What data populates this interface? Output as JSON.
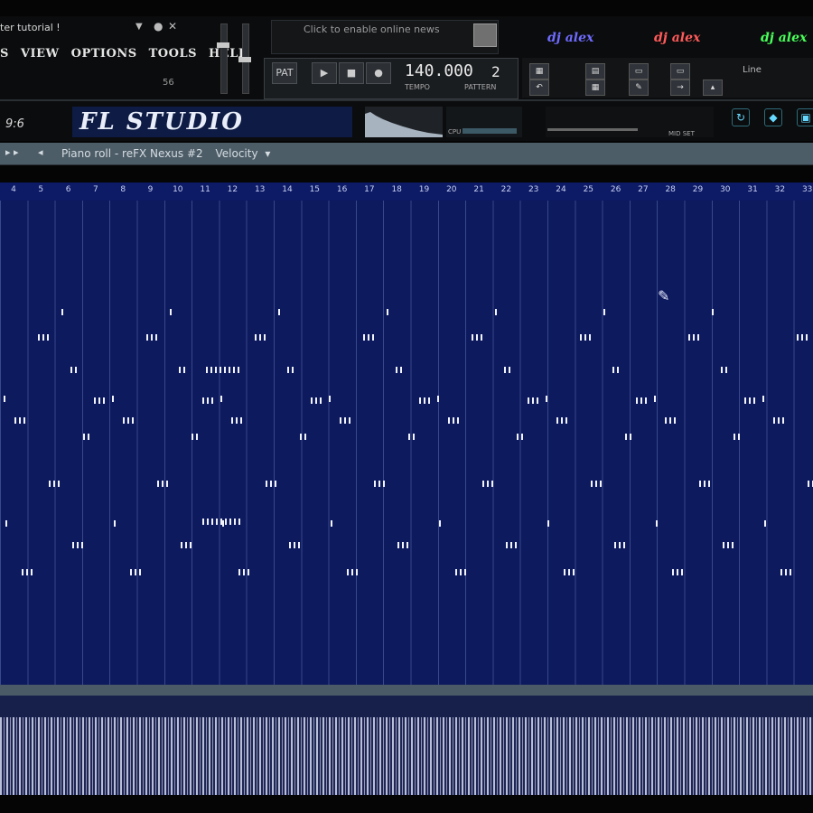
{
  "window": {
    "title": "ter tutorial !"
  },
  "menu": [
    "S",
    "VIEW",
    "OPTIONS",
    "TOOLS",
    "HELP"
  ],
  "readout_small": "56",
  "hint": {
    "text": "Click to enable online news"
  },
  "brand_logos": [
    {
      "text": "dj alex",
      "color": "#6f6bff"
    },
    {
      "text": "dj alex",
      "color": "#ff5a5a"
    },
    {
      "text": "dj alex",
      "color": "#48ff5a"
    }
  ],
  "transport": {
    "buttons": [
      "PAT",
      "▶",
      "■",
      "●"
    ],
    "tempo": "140.000",
    "tempo_label": "TEMPO",
    "pattern": "2",
    "pattern_label": "PATTERN",
    "line_label": "Line"
  },
  "counter": "9:6",
  "fl_logo": "FL STUDIO",
  "cpu_label": "CPU",
  "tail_labels": "MID  SET",
  "piano_roll": {
    "menu_symbol": "▸ ▸",
    "arrow": "◂",
    "title": "Piano roll - reFX Nexus #2",
    "subtitle": "Velocity"
  },
  "ruler": [
    "4",
    "5",
    "6",
    "7",
    "8",
    "9",
    "10",
    "11",
    "12",
    "13",
    "14",
    "15",
    "16",
    "17",
    "18",
    "19",
    "20",
    "21",
    "22",
    "23",
    "24",
    "25",
    "26",
    "27",
    "28",
    "29",
    "30",
    "31",
    "32",
    "33"
  ],
  "colors": {
    "grid_bg": "#0d1a5e",
    "note": "#f2f4ff",
    "header": "#4d5d68"
  }
}
